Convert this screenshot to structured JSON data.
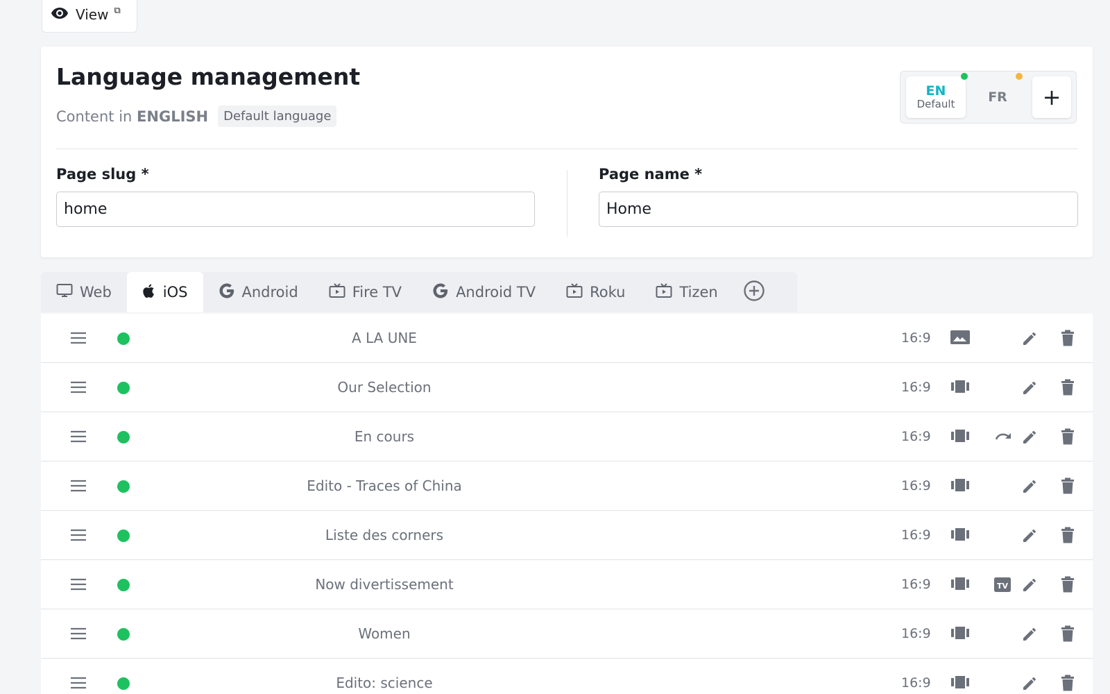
{
  "view_button": {
    "label": "View",
    "external_glyph": "⧉"
  },
  "language": {
    "title": "Language management",
    "content_prefix": "Content in",
    "content_language": "ENGLISH",
    "default_tag": "Default language",
    "switcher": {
      "en_code": "EN",
      "en_label": "Default",
      "fr_code": "FR",
      "add_label": "+"
    },
    "status_colors": {
      "en": "#1ec15f",
      "fr": "#f5b53f"
    }
  },
  "fields": {
    "slug_label": "Page slug *",
    "slug_value": "home",
    "name_label": "Page name *",
    "name_value": "Home"
  },
  "tabs": [
    {
      "label": "Web",
      "icon": "monitor-icon"
    },
    {
      "label": "iOS",
      "icon": "apple-icon"
    },
    {
      "label": "Android",
      "icon": "google-icon"
    },
    {
      "label": "Fire TV",
      "icon": "tv-icon"
    },
    {
      "label": "Android TV",
      "icon": "google-icon"
    },
    {
      "label": "Roku",
      "icon": "tv-icon"
    },
    {
      "label": "Tizen",
      "icon": "tv-icon"
    }
  ],
  "active_tab": "iOS",
  "rows": [
    {
      "title": "A LA UNE",
      "ratio": "16:9",
      "type_icon": "image-icon",
      "extra_icon": ""
    },
    {
      "title": "Our Selection",
      "ratio": "16:9",
      "type_icon": "carousel-icon",
      "extra_icon": ""
    },
    {
      "title": "En cours",
      "ratio": "16:9",
      "type_icon": "carousel-icon",
      "extra_icon": "redo-icon"
    },
    {
      "title": "Edito - Traces of China",
      "ratio": "16:9",
      "type_icon": "carousel-icon",
      "extra_icon": ""
    },
    {
      "title": "Liste des corners",
      "ratio": "16:9",
      "type_icon": "carousel-icon",
      "extra_icon": ""
    },
    {
      "title": "Now divertissement",
      "ratio": "16:9",
      "type_icon": "carousel-icon",
      "extra_icon": "tv-badge-icon"
    },
    {
      "title": "Women",
      "ratio": "16:9",
      "type_icon": "carousel-icon",
      "extra_icon": ""
    },
    {
      "title": "Edito: science",
      "ratio": "16:9",
      "type_icon": "carousel-icon",
      "extra_icon": ""
    }
  ],
  "tv_badge_text": "TV",
  "colors": {
    "active_status": "#1ec15f",
    "accent": "#0fb6c4",
    "icon_gray": "#6b707a"
  }
}
